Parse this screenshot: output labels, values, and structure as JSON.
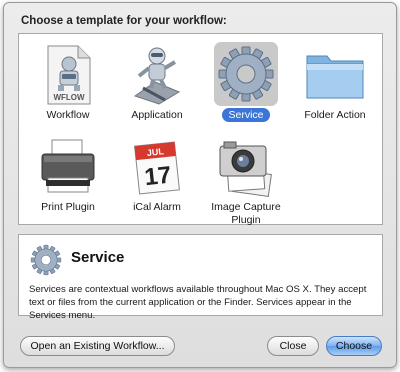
{
  "dialog": {
    "prompt": "Choose a template for your workflow:"
  },
  "templates": [
    {
      "label": "Workflow",
      "icon": "workflow-document-icon",
      "badge": "WFLOW"
    },
    {
      "label": "Application",
      "icon": "automator-robot-icon"
    },
    {
      "label": "Service",
      "icon": "gear-icon",
      "selected": true
    },
    {
      "label": "Folder Action",
      "icon": "folder-icon"
    },
    {
      "label": "Print Plugin",
      "icon": "printer-icon"
    },
    {
      "label": "iCal Alarm",
      "icon": "calendar-icon",
      "month": "JUL",
      "day": "17"
    },
    {
      "label": "Image Capture Plugin",
      "icon": "camera-icon"
    }
  ],
  "description": {
    "title": "Service",
    "icon": "gear-icon",
    "text": "Services are contextual workflows available throughout Mac OS X. They accept text or files from the current application or the Finder. Services appear in the Services menu."
  },
  "buttons": {
    "open_existing": "Open an Existing Workflow...",
    "close": "Close",
    "choose": "Choose"
  },
  "colors": {
    "selection": "#3c75d8",
    "primary_button": "#6aa6ec"
  }
}
